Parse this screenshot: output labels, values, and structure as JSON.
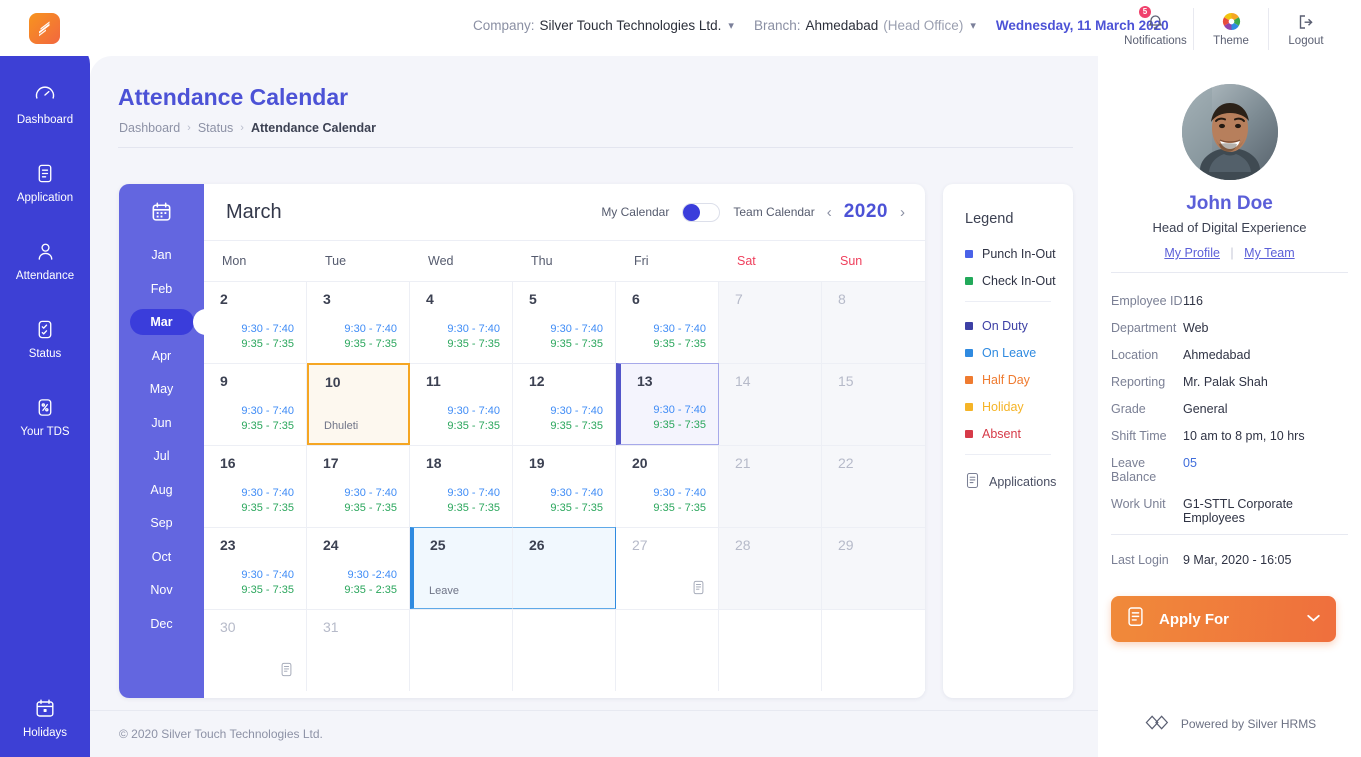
{
  "topbar": {
    "logo_icon": "app-logo-icon",
    "company_label": "Company:",
    "company_value": "Silver Touch Technologies Ltd.",
    "branch_label": "Branch:",
    "branch_value": "Ahmedabad",
    "branch_sub": "(Head Office)",
    "date": "Wednesday, 11 March 2020",
    "actions": [
      {
        "label": "Notifications",
        "icon": "bell-icon",
        "badge": "5"
      },
      {
        "label": "Theme",
        "icon": "theme-palette-icon",
        "badge": ""
      },
      {
        "label": "Logout",
        "icon": "logout-icon",
        "badge": ""
      }
    ]
  },
  "sidebar": {
    "items": [
      {
        "label": "Dashboard",
        "icon": "speedometer-icon"
      },
      {
        "label": "Application",
        "icon": "document-icon"
      },
      {
        "label": "Attendance",
        "icon": "person-icon"
      },
      {
        "label": "Status",
        "icon": "checklist-icon"
      },
      {
        "label": "Your TDS",
        "icon": "percent-icon"
      }
    ],
    "bottom": {
      "label": "Holidays",
      "icon": "calendar-icon"
    }
  },
  "page": {
    "title": "Attendance Calendar",
    "breadcrumb": [
      "Dashboard",
      "Status",
      "Attendance Calendar"
    ],
    "footer": "© 2020 Silver Touch Technologies Ltd."
  },
  "calendar": {
    "months_icon": "calendar-icon",
    "months": [
      "Jan",
      "Feb",
      "Mar",
      "Apr",
      "May",
      "Jun",
      "Jul",
      "Aug",
      "Sep",
      "Oct",
      "Nov",
      "Dec"
    ],
    "active_month": "Mar",
    "month_title": "March",
    "year": "2020",
    "toggle_left_label": "My Calendar",
    "toggle_right_label": "Team Calendar",
    "toggle_state": "my-calendar",
    "prev_icon": "chevron-left-icon",
    "next_icon": "chevron-right-icon",
    "dow": [
      "Mon",
      "Tue",
      "Wed",
      "Thu",
      "Fri",
      "Sat",
      "Sun"
    ],
    "weeks": [
      [
        {
          "day": "2",
          "punch": "9:30 - 7:40",
          "check": "9:35 - 7:35",
          "note": "",
          "state": "normal",
          "app": false
        },
        {
          "day": "3",
          "punch": "9:30 - 7:40",
          "check": "9:35 - 7:35",
          "note": "",
          "state": "normal",
          "app": false
        },
        {
          "day": "4",
          "punch": "9:30 - 7:40",
          "check": "9:35 - 7:35",
          "note": "",
          "state": "normal",
          "app": false
        },
        {
          "day": "5",
          "punch": "9:30 - 7:40",
          "check": "9:35 - 7:35",
          "note": "",
          "state": "normal",
          "app": false
        },
        {
          "day": "6",
          "punch": "9:30 - 7:40",
          "check": "9:35 - 7:35",
          "note": "",
          "state": "normal",
          "app": false
        },
        {
          "day": "7",
          "punch": "",
          "check": "",
          "note": "",
          "state": "weekend",
          "app": false
        },
        {
          "day": "8",
          "punch": "",
          "check": "",
          "note": "",
          "state": "weekend",
          "app": false
        }
      ],
      [
        {
          "day": "9",
          "punch": "9:30 - 7:40",
          "check": "9:35 - 7:35",
          "note": "",
          "state": "normal",
          "app": false
        },
        {
          "day": "10",
          "punch": "",
          "check": "",
          "note": "Dhuleti",
          "state": "holiday",
          "app": false
        },
        {
          "day": "11",
          "punch": "9:30 - 7:40",
          "check": "9:35 - 7:35",
          "note": "",
          "state": "normal",
          "app": false
        },
        {
          "day": "12",
          "punch": "9:30 - 7:40",
          "check": "9:35 - 7:35",
          "note": "",
          "state": "normal",
          "app": false
        },
        {
          "day": "13",
          "punch": "9:30 - 7:40",
          "check": "9:35 - 7:35",
          "note": "",
          "state": "today",
          "app": false
        },
        {
          "day": "14",
          "punch": "",
          "check": "",
          "note": "",
          "state": "weekend",
          "app": false
        },
        {
          "day": "15",
          "punch": "",
          "check": "",
          "note": "",
          "state": "weekend",
          "app": false
        }
      ],
      [
        {
          "day": "16",
          "punch": "9:30 - 7:40",
          "check": "9:35 - 7:35",
          "note": "",
          "state": "normal",
          "app": false
        },
        {
          "day": "17",
          "punch": "9:30 - 7:40",
          "check": "9:35 - 7:35",
          "note": "",
          "state": "normal",
          "app": false
        },
        {
          "day": "18",
          "punch": "9:30 - 7:40",
          "check": "9:35 - 7:35",
          "note": "",
          "state": "normal",
          "app": false
        },
        {
          "day": "19",
          "punch": "9:30 - 7:40",
          "check": "9:35 - 7:35",
          "note": "",
          "state": "normal",
          "app": false
        },
        {
          "day": "20",
          "punch": "9:30 - 7:40",
          "check": "9:35 - 7:35",
          "note": "",
          "state": "normal",
          "app": false
        },
        {
          "day": "21",
          "punch": "",
          "check": "",
          "note": "",
          "state": "weekend",
          "app": false
        },
        {
          "day": "22",
          "punch": "",
          "check": "",
          "note": "",
          "state": "weekend",
          "app": false
        }
      ],
      [
        {
          "day": "23",
          "punch": "9:30 - 7:40",
          "check": "9:35 - 7:35",
          "note": "",
          "state": "normal",
          "app": false
        },
        {
          "day": "24",
          "punch": "9:30 -2:40",
          "check": "9:35 - 2:35",
          "note": "",
          "state": "normal",
          "app": false
        },
        {
          "day": "25",
          "punch": "",
          "check": "",
          "note": "Leave",
          "state": "selected-start",
          "app": false
        },
        {
          "day": "26",
          "punch": "",
          "check": "",
          "note": "",
          "state": "selected-end",
          "app": false
        },
        {
          "day": "27",
          "punch": "",
          "check": "",
          "note": "",
          "state": "future",
          "app": true
        },
        {
          "day": "28",
          "punch": "",
          "check": "",
          "note": "",
          "state": "weekend",
          "app": false
        },
        {
          "day": "29",
          "punch": "",
          "check": "",
          "note": "",
          "state": "weekend",
          "app": false
        }
      ],
      [
        {
          "day": "30",
          "punch": "",
          "check": "",
          "note": "",
          "state": "future",
          "app": true
        },
        {
          "day": "31",
          "punch": "",
          "check": "",
          "note": "",
          "state": "future",
          "app": false
        },
        {
          "day": "",
          "punch": "",
          "check": "",
          "note": "",
          "state": "blank",
          "app": false
        },
        {
          "day": "",
          "punch": "",
          "check": "",
          "note": "",
          "state": "blank",
          "app": false
        },
        {
          "day": "",
          "punch": "",
          "check": "",
          "note": "",
          "state": "blank",
          "app": false
        },
        {
          "day": "",
          "punch": "",
          "check": "",
          "note": "",
          "state": "blank",
          "app": false
        },
        {
          "day": "",
          "punch": "",
          "check": "",
          "note": "",
          "state": "blank",
          "app": false
        }
      ]
    ]
  },
  "legend": {
    "title": "Legend",
    "group1": [
      {
        "label": "Punch In-Out",
        "color": "#4a62e8",
        "text_color": "#2f3344"
      },
      {
        "label": "Check In-Out",
        "color": "#22a95a",
        "text_color": "#2f3344"
      }
    ],
    "group2": [
      {
        "label": "On Duty",
        "color": "#3d40a5",
        "text_color": "#3d40a5"
      },
      {
        "label": "On Leave",
        "color": "#2f8ae0",
        "text_color": "#2f8ae0"
      },
      {
        "label": "Half Day",
        "color": "#ef7b30",
        "text_color": "#ef7b30"
      },
      {
        "label": "Holiday",
        "color": "#f5b427",
        "text_color": "#f5b427"
      },
      {
        "label": "Absent",
        "color": "#d63a48",
        "text_color": "#d63a48"
      }
    ],
    "applications_label": "Applications",
    "applications_icon": "application-doc-icon"
  },
  "profile": {
    "avatar_icon": "user-photo-avatar",
    "name": "John Doe",
    "role": "Head of Digital Experience",
    "link_profile": "My Profile",
    "link_team": "My Team",
    "fields": [
      {
        "key": "Employee ID",
        "value": "116",
        "link": false
      },
      {
        "key": "Department",
        "value": "Web",
        "link": false
      },
      {
        "key": "Location",
        "value": "Ahmedabad",
        "link": false
      },
      {
        "key": "Reporting",
        "value": "Mr. Palak Shah",
        "link": false
      },
      {
        "key": "Grade",
        "value": "General",
        "link": false
      },
      {
        "key": "Shift Time",
        "value": "10 am to 8 pm, 10 hrs",
        "link": false
      },
      {
        "key": "Leave Balance",
        "value": "05",
        "link": true
      },
      {
        "key": "Work Unit",
        "value": "G1-STTL Corporate Employees",
        "link": false
      }
    ],
    "last_login_key": "Last Login",
    "last_login_value": "9 Mar, 2020 - 16:05",
    "apply_button": "Apply For",
    "apply_icon": "application-doc-icon",
    "apply_caret_icon": "chevron-down-icon",
    "powered_by": "Powered by Silver HRMS",
    "powered_icon": "silver-hrms-logo-icon"
  },
  "colors": {
    "brand_blue": "#3d40d5",
    "accent_purple": "#6366e0",
    "orange": "#ef7b30",
    "weekend_red": "#ef3f5c"
  }
}
